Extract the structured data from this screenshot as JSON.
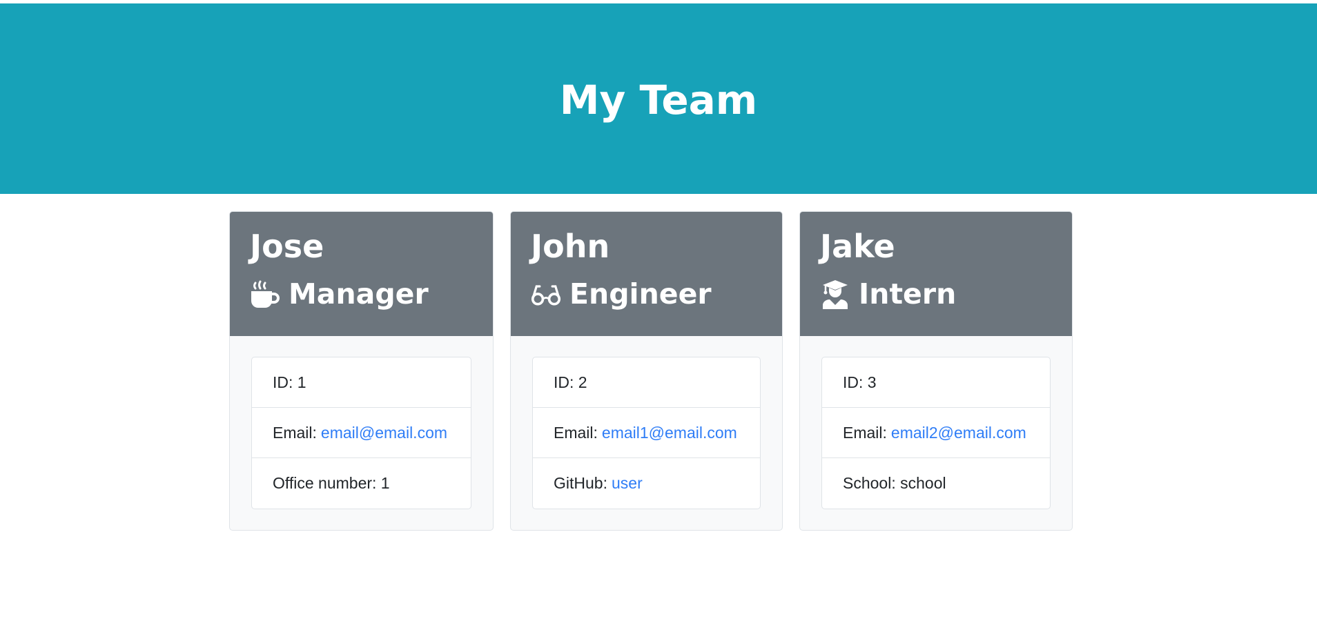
{
  "header": {
    "title": "My Team"
  },
  "cards": [
    {
      "name": "Jose",
      "role": "Manager",
      "role_icon": "coffee-mug-icon",
      "id_label": "ID: 1",
      "email_label": "Email:",
      "email": "email@email.com",
      "extra_label": "Office number: 1"
    },
    {
      "name": "John",
      "role": "Engineer",
      "role_icon": "glasses-icon",
      "id_label": "ID: 2",
      "email_label": "Email:",
      "email": "email1@email.com",
      "extra_label": "GitHub:",
      "extra_link": "user"
    },
    {
      "name": "Jake",
      "role": "Intern",
      "role_icon": "graduate-icon",
      "id_label": "ID: 3",
      "email_label": "Email:",
      "email": "email2@email.com",
      "extra_label": "School: school"
    }
  ],
  "colors": {
    "banner": "#17a2b8",
    "card_header": "#6c757d",
    "link": "#2f7df6"
  }
}
